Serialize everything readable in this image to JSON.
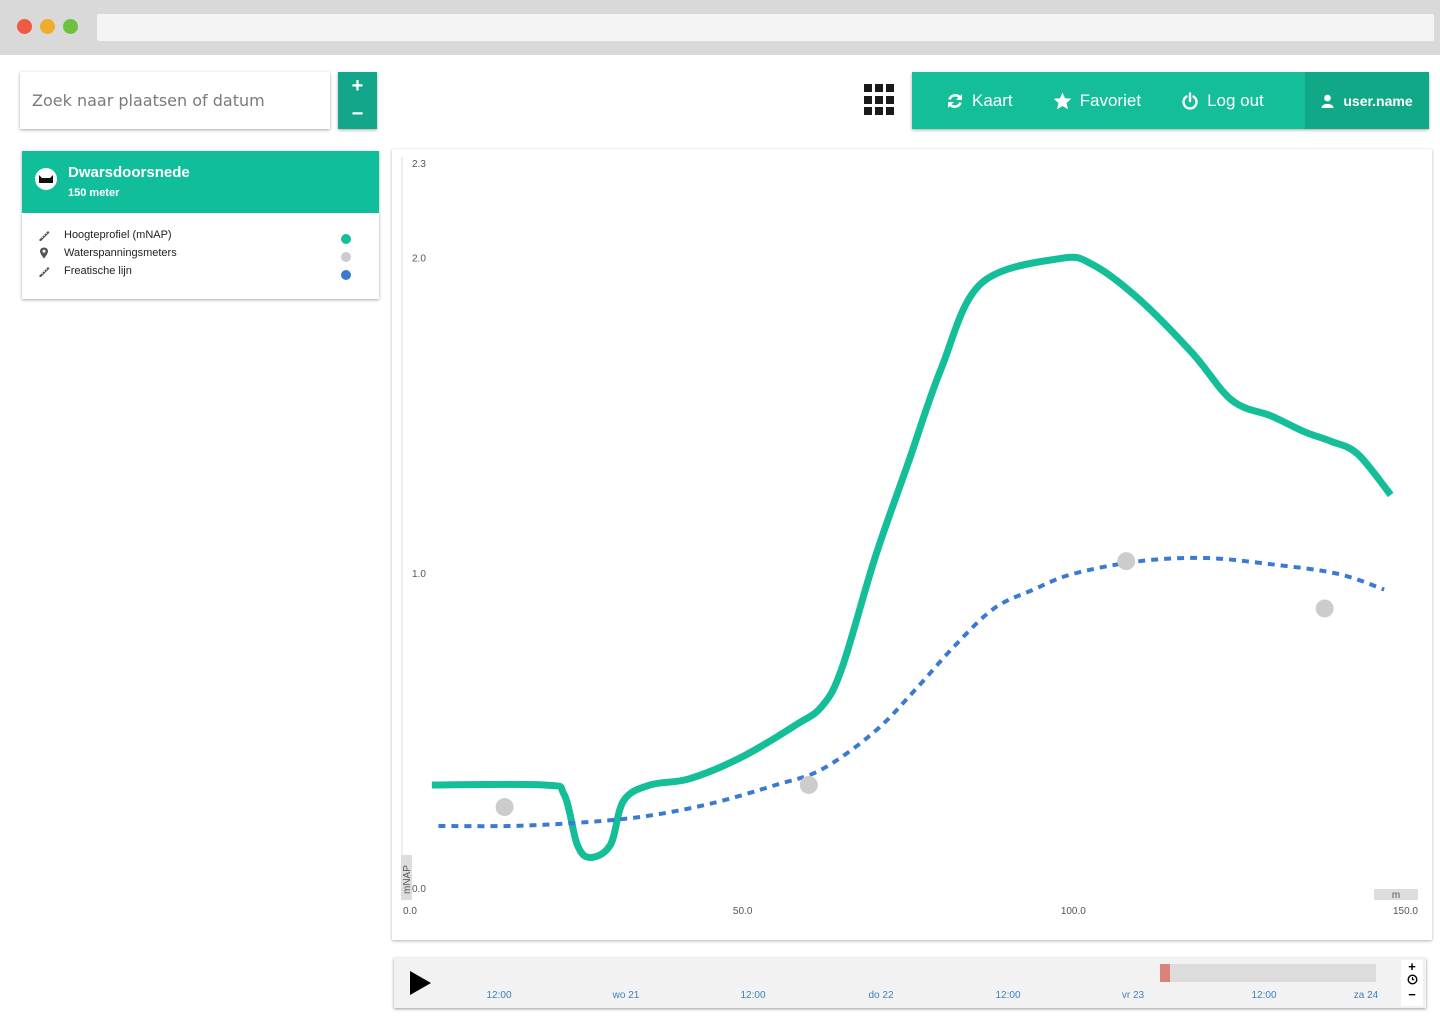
{
  "search": {
    "placeholder": "Zoek naar plaatsen of datum"
  },
  "zoom": {
    "plus": "+",
    "minus": "−"
  },
  "nav": {
    "kaart": "Kaart",
    "favoriet": "Favoriet",
    "logout": "Log out",
    "user": "user.name"
  },
  "card": {
    "title": "Dwarsdoorsnede",
    "subtitle": "150 meter",
    "legend": [
      {
        "label": "Hoogteprofiel (mNAP)",
        "icon": "ruler-icon",
        "color": "#13be98"
      },
      {
        "label": "Waterspanningsmeters",
        "icon": "pin-icon",
        "color": "#cccccc"
      },
      {
        "label": "Freatische lijn",
        "icon": "ruler-icon",
        "color": "#3a7ad1"
      }
    ]
  },
  "chart_data": {
    "type": "line",
    "ylabel": "mNAP",
    "xlabel": "m",
    "yticks": [
      "0.0",
      "1.0",
      "2.0",
      "2.3"
    ],
    "xticks": [
      "0.0",
      "50.0",
      "100.0",
      "150.0"
    ],
    "xlim": [
      0,
      150
    ],
    "ylim": [
      0,
      2.3
    ],
    "series": [
      {
        "name": "Hoogteprofiel (mNAP)",
        "color": "#13be98",
        "style": "solid",
        "points": [
          [
            3,
            0.33
          ],
          [
            20,
            0.33
          ],
          [
            23,
            0.3
          ],
          [
            25,
            0.14
          ],
          [
            27,
            0.1
          ],
          [
            30,
            0.14
          ],
          [
            32,
            0.28
          ],
          [
            36,
            0.33
          ],
          [
            42,
            0.35
          ],
          [
            50,
            0.42
          ],
          [
            58,
            0.52
          ],
          [
            62,
            0.58
          ],
          [
            65,
            0.7
          ],
          [
            70,
            1.05
          ],
          [
            75,
            1.35
          ],
          [
            80,
            1.65
          ],
          [
            86,
            1.92
          ],
          [
            98,
            2.0
          ],
          [
            103,
            1.98
          ],
          [
            110,
            1.87
          ],
          [
            118,
            1.7
          ],
          [
            124,
            1.55
          ],
          [
            130,
            1.5
          ],
          [
            135,
            1.45
          ],
          [
            139,
            1.42
          ],
          [
            143,
            1.38
          ],
          [
            148,
            1.25
          ]
        ]
      },
      {
        "name": "Freatische lijn",
        "color": "#3a7ad1",
        "style": "dashed",
        "points": [
          [
            4,
            0.2
          ],
          [
            15,
            0.2
          ],
          [
            25,
            0.21
          ],
          [
            35,
            0.23
          ],
          [
            45,
            0.27
          ],
          [
            55,
            0.33
          ],
          [
            62,
            0.38
          ],
          [
            70,
            0.5
          ],
          [
            76,
            0.63
          ],
          [
            82,
            0.77
          ],
          [
            88,
            0.89
          ],
          [
            94,
            0.95
          ],
          [
            100,
            1.0
          ],
          [
            110,
            1.04
          ],
          [
            120,
            1.05
          ],
          [
            130,
            1.03
          ],
          [
            140,
            1.0
          ],
          [
            147,
            0.95
          ]
        ]
      },
      {
        "name": "Waterspanningsmeters",
        "color": "#cccccc",
        "style": "points",
        "points": [
          [
            14,
            0.26
          ],
          [
            60,
            0.33
          ],
          [
            108,
            1.04
          ],
          [
            138,
            0.89
          ]
        ]
      }
    ]
  },
  "timeline": {
    "labels": [
      "12:00",
      "wo 21",
      "12:00",
      "do 22",
      "12:00",
      "vr 23",
      "12:00",
      "za 24"
    ],
    "controls": {
      "plus": "+",
      "minus": "−"
    }
  }
}
